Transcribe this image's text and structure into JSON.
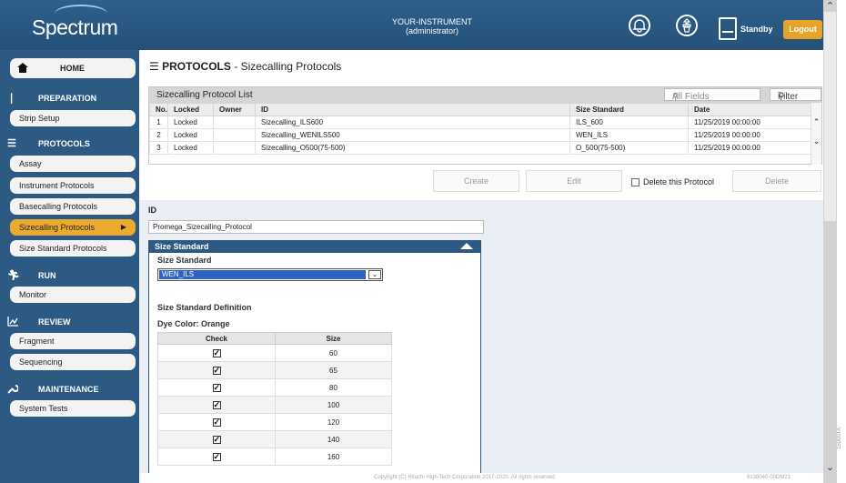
{
  "header": {
    "logo": "Spectrum",
    "instrument_name": "YOUR-INSTRUMENT",
    "user_role": "(administrator)",
    "status_label": "Standby",
    "logout_label": "Logout"
  },
  "sidebar": {
    "home": "HOME",
    "preparation": "PREPARATION",
    "strip_setup": "Strip Setup",
    "protocols": "PROTOCOLS",
    "assay": "Assay",
    "instrument_protocols": "Instrument Protocols",
    "basecalling_protocols": "Basecalling Protocols",
    "sizecalling_protocols": "Sizecalling Protocols",
    "size_standard_protocols": "Size Standard Protocols",
    "run": "RUN",
    "monitor": "Monitor",
    "review": "REVIEW",
    "fragment": "Fragment",
    "sequencing": "Sequencing",
    "maintenance": "MAINTENANCE",
    "system_tests": "System Tests"
  },
  "page": {
    "title_bold": "PROTOCOLS",
    "title_rest": " - Sizecalling Protocols"
  },
  "protocol_list": {
    "title": "Sizecalling Protocol List",
    "search_placeholder": "All Fields",
    "filter_label": "Filter",
    "columns": [
      "No.",
      "Locked",
      "Owner",
      "ID",
      "Size Standard",
      "Date"
    ],
    "rows": [
      {
        "no": "1",
        "locked": "Locked",
        "owner": "",
        "id": "Sizecalling_ILS600",
        "size_standard": "ILS_600",
        "date": "11/25/2019 00:00:00"
      },
      {
        "no": "2",
        "locked": "Locked",
        "owner": "",
        "id": "Sizecalling_WENILS500",
        "size_standard": "WEN_ILS",
        "date": "11/25/2019 00:00:00"
      },
      {
        "no": "3",
        "locked": "Locked",
        "owner": "",
        "id": "Sizecalling_O500(75-500)",
        "size_standard": "O_500(75-500)",
        "date": "11/25/2019 00:00:00"
      }
    ]
  },
  "actions": {
    "create": "Create",
    "edit": "Edit",
    "delete_checkbox": "Delete this Protocol",
    "delete": "Delete"
  },
  "detail": {
    "id_label": "ID",
    "id_value": "Promega_Sizecalling_Protocol",
    "panel_title": "Size Standard",
    "size_standard_label": "Size Standard",
    "size_standard_value": "WEN_ILS",
    "definition_label": "Size Standard Definition",
    "dye_color": "Dye Color: Orange",
    "table_headers": [
      "Check",
      "Size"
    ],
    "sizes": [
      {
        "checked": true,
        "size": "60"
      },
      {
        "checked": true,
        "size": "65"
      },
      {
        "checked": true,
        "size": "80"
      },
      {
        "checked": true,
        "size": "100"
      },
      {
        "checked": true,
        "size": "120"
      },
      {
        "checked": true,
        "size": "140"
      },
      {
        "checked": true,
        "size": "160"
      }
    ]
  },
  "footer": {
    "copyright": "Copyright (C) Hitachi High-Tech Corporation 2017-2020. All rights reserved.",
    "version": "6138040-00DM21"
  },
  "watermark": "15000TA",
  "colors": {
    "header": "#2f5f8c",
    "sidebar": "#2d5a82",
    "active": "#ecaa2e",
    "logout": "#e6a32a"
  }
}
